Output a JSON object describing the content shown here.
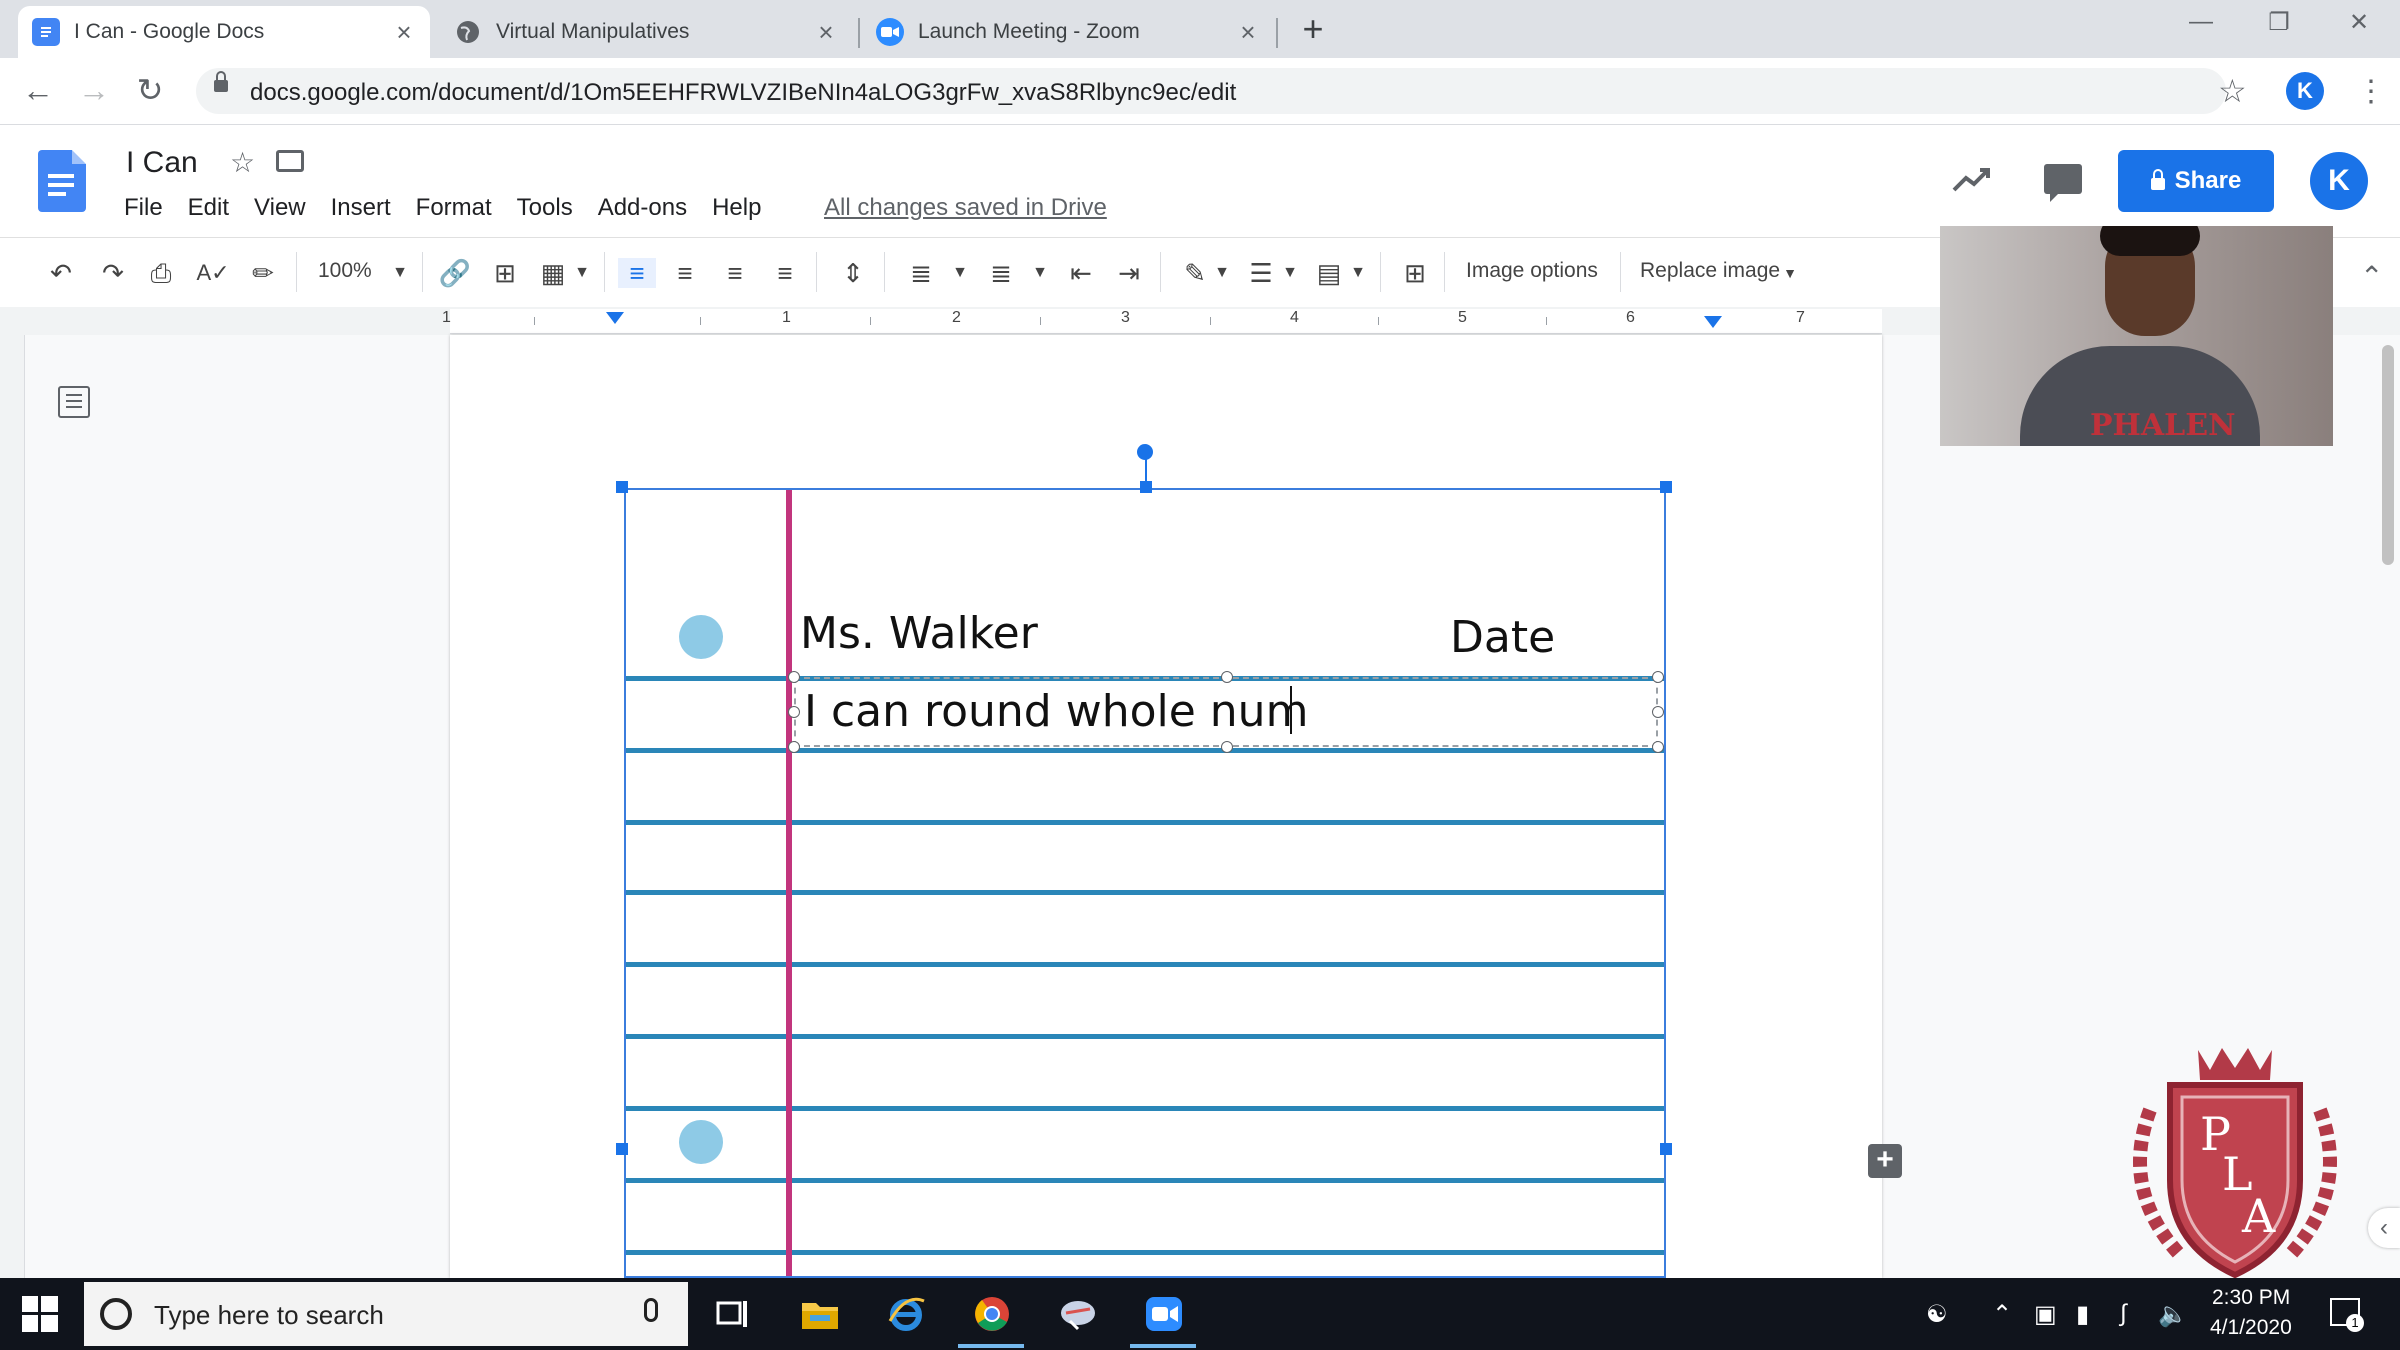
{
  "browser": {
    "tabs": [
      {
        "title": "I Can - Google Docs",
        "active": true,
        "icon": "google-docs-icon"
      },
      {
        "title": "Virtual Manipulatives",
        "active": false,
        "icon": "globe-icon"
      },
      {
        "title": "Launch Meeting - Zoom",
        "active": false,
        "icon": "zoom-icon"
      }
    ],
    "url": "docs.google.com/document/d/1Om5EEHFRWLVZIBeNIn4aLOG3grFw_xvaS8Rlbync9ec/edit",
    "profile_initial": "K"
  },
  "docs": {
    "title": "I Can",
    "menu": [
      "File",
      "Edit",
      "View",
      "Insert",
      "Format",
      "Tools",
      "Add-ons",
      "Help"
    ],
    "save_status": "All changes saved in Drive",
    "share_label": "Share",
    "account_initial": "K"
  },
  "toolbar": {
    "zoom": "100%",
    "image_options": "Image options",
    "replace_image": "Replace image"
  },
  "ruler": {
    "labels": [
      "1",
      "1",
      "2",
      "3",
      "4",
      "5",
      "6",
      "7"
    ]
  },
  "document": {
    "teacher_name": "Ms. Walker",
    "date_label": "Date",
    "typed_text": "I can round whole num"
  },
  "webcam": {
    "shirt_text": "PHALEN"
  },
  "crest": {
    "letters": [
      "P",
      "L",
      "A"
    ]
  },
  "taskbar": {
    "search_placeholder": "Type here to search",
    "time": "2:30 PM",
    "date": "4/1/2020",
    "notification_count": "1"
  },
  "colors": {
    "accent": "#1a73e8",
    "paper_line": "#2a86b8",
    "margin_line": "#c2357d",
    "hole": "#8ecae6",
    "taskbar": "#10141c"
  }
}
